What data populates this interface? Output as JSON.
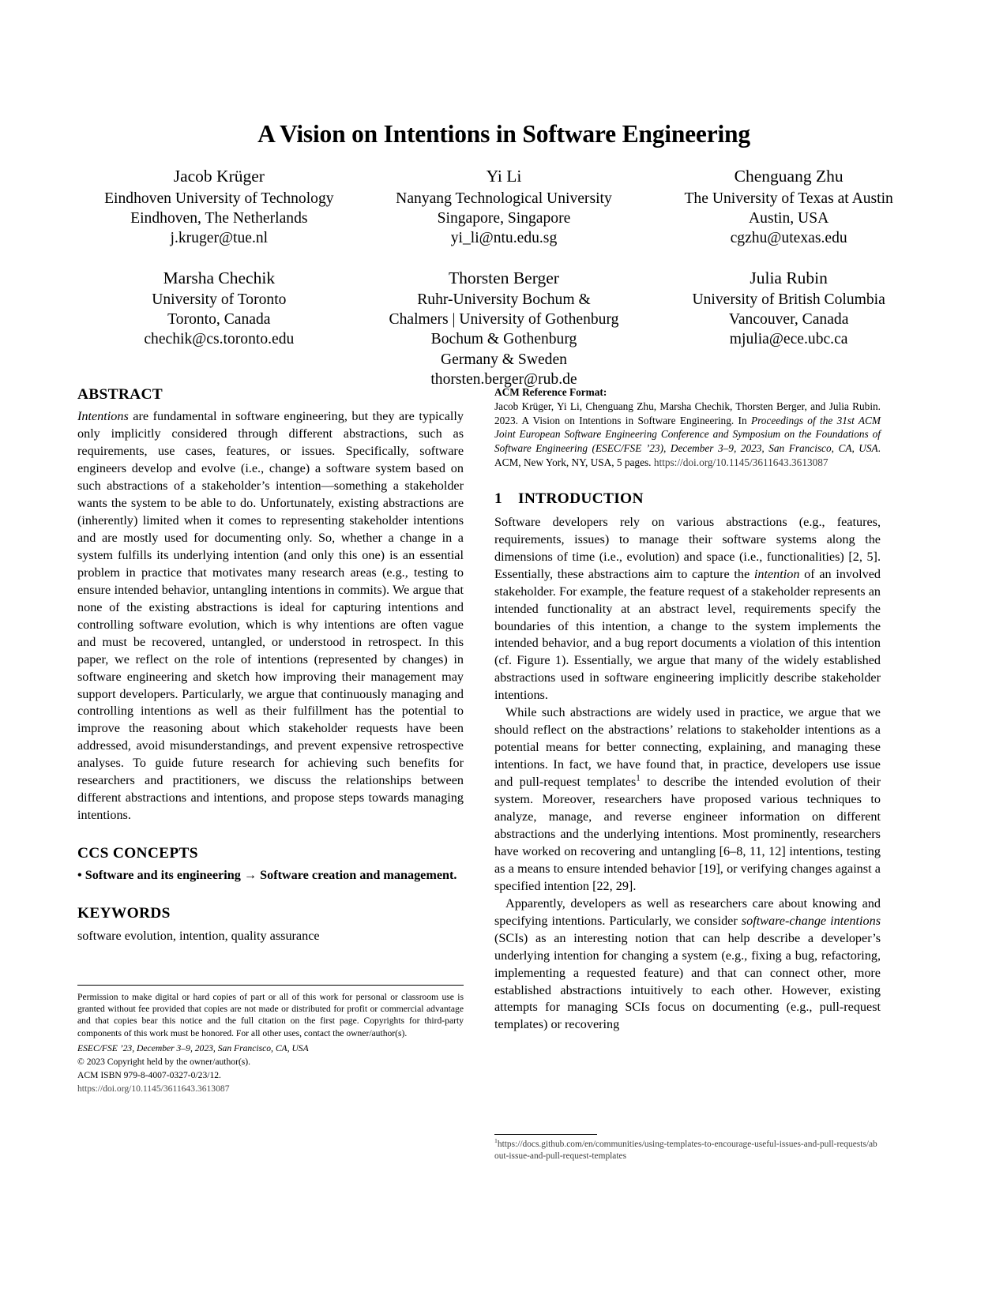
{
  "paper": {
    "title": "A Vision on Intentions in Software Engineering",
    "authors": [
      {
        "name": "Jacob Krüger",
        "affiliation": "Eindhoven University of Technology",
        "location": "Eindhoven, The Netherlands",
        "email": "j.kruger@tue.nl"
      },
      {
        "name": "Yi Li",
        "affiliation": "Nanyang Technological University",
        "location": "Singapore, Singapore",
        "email": "yi_li@ntu.edu.sg"
      },
      {
        "name": "Chenguang Zhu",
        "affiliation": "The University of Texas at Austin",
        "location": "Austin, USA",
        "email": "cgzhu@utexas.edu"
      },
      {
        "name": "Marsha Chechik",
        "affiliation": "University of Toronto",
        "location": "Toronto, Canada",
        "email": "chechik@cs.toronto.edu"
      },
      {
        "name": "Thorsten Berger",
        "affiliation": "Ruhr-University Bochum &",
        "affiliation2": "Chalmers | University of Gothenburg",
        "location": "Bochum & Gothenburg",
        "location2": "Germany & Sweden",
        "email": "thorsten.berger@rub.de"
      },
      {
        "name": "Julia Rubin",
        "affiliation": "University of British Columbia",
        "location": "Vancouver, Canada",
        "email": "mjulia@ece.ubc.ca"
      }
    ],
    "abstract": {
      "heading": "ABSTRACT",
      "lead_italic": "Intentions",
      "text": " are fundamental in software engineering, but they are typically only implicitly considered through different abstractions, such as requirements, use cases, features, or issues. Specifically, software engineers develop and evolve (i.e., change) a software system based on such abstractions of a stakeholder’s intention—something a stakeholder wants the system to be able to do. Unfortunately, existing abstractions are (inherently) limited when it comes to representing stakeholder intentions and are mostly used for documenting only. So, whether a change in a system fulfills its underlying intention (and only this one) is an essential problem in practice that motivates many research areas (e.g., testing to ensure intended behavior, untangling intentions in commits). We argue that none of the existing abstractions is ideal for capturing intentions and controlling software evolution, which is why intentions are often vague and must be recovered, untangled, or understood in retrospect. In this paper, we reflect on the role of intentions (represented by changes) in software engineering and sketch how improving their management may support developers. Particularly, we argue that continuously managing and controlling intentions as well as their fulfillment has the potential to improve the reasoning about which stakeholder requests have been addressed, avoid misunderstandings, and prevent expensive retrospective analyses. To guide future research for achieving such benefits for researchers and practitioners, we discuss the relationships between different abstractions and intentions, and propose steps towards managing intentions."
    },
    "ccs": {
      "heading": "CCS CONCEPTS",
      "bullet": "•",
      "text": " Software and its engineering → Software creation and management."
    },
    "keywords": {
      "heading": "KEYWORDS",
      "text": "software evolution, intention, quality assurance"
    },
    "copyright": {
      "permission": "Permission to make digital or hard copies of part or all of this work for personal or classroom use is granted without fee provided that copies are not made or distributed for profit or commercial advantage and that copies bear this notice and the full citation on the first page. Copyrights for third-party components of this work must be honored. For all other uses, contact the owner/author(s).",
      "conference": "ESEC/FSE ’23, December 3–9, 2023, San Francisco, CA, USA",
      "copyright_line": "© 2023 Copyright held by the owner/author(s).",
      "isbn": "ACM ISBN 979-8-4007-0327-0/23/12.",
      "doi": "https://doi.org/10.1145/3611643.3613087"
    },
    "acm_reference": {
      "heading": "ACM Reference Format:",
      "part1": "Jacob Krüger, Yi Li, Chenguang Zhu, Marsha Chechik, Thorsten Berger, and Julia Rubin. 2023. A Vision on Intentions in Software Engineering. In ",
      "italic_part": "Proceedings of the 31st ACM Joint European Software Engineering Conference and Symposium on the Foundations of Software Engineering (ESEC/FSE ’23), December 3–9, 2023, San Francisco, CA, USA",
      "part2": ". ACM, New York, NY, USA, 5 pages. ",
      "doi": "https://doi.org/10.1145/3611643.3613087"
    },
    "introduction": {
      "number": "1",
      "heading": "INTRODUCTION",
      "para1_a": "Software developers rely on various abstractions (e.g., features, requirements, issues) to manage their software systems along the dimensions of time (i.e., evolution) and space (i.e., functionalities) [2, 5]. Essentially, these abstractions aim to capture the ",
      "para1_italic": "intention",
      "para1_b": " of an involved stakeholder. For example, the feature request of a stakeholder represents an intended functionality at an abstract level, requirements specify the boundaries of this intention, a change to the system implements the intended behavior, and a bug report documents a violation of this intention (cf. Figure 1). Essentially, we argue that many of the widely established abstractions used in software engineering implicitly describe stakeholder intentions.",
      "para2_a": "While such abstractions are widely used in practice, we argue that we should reflect on the abstractions’ relations to stakeholder intentions as a potential means for better connecting, explaining, and managing these intentions. In fact, we have found that, in practice, developers use issue and pull-request templates",
      "para2_footnote_marker": "1",
      "para2_b": " to describe the intended evolution of their system. Moreover, researchers have proposed various techniques to analyze, manage, and reverse engineer information on different abstractions and the underlying intentions. Most prominently, researchers have worked on recovering and untangling [6–8, 11, 12] intentions, testing as a means to ensure intended behavior [19], or verifying changes against a specified intention [22, 29].",
      "para3_a": "Apparently, developers as well as researchers care about knowing and specifying intentions. Particularly, we consider ",
      "para3_italic": "software-change intentions",
      "para3_b": " (SCIs) as an interesting notion that can help describe a developer’s underlying intention for changing a system (e.g., fixing a bug, refactoring, implementing a requested feature) and that can connect other, more established abstractions intuitively to each other. However, existing attempts for managing SCIs focus on documenting (e.g., pull-request templates) or recovering"
    },
    "footnote": {
      "marker": "1",
      "url": "https://docs.github.com/en/communities/using-templates-to-encourage-useful-issues-and-pull-requests/about-issue-and-pull-request-templates"
    }
  }
}
